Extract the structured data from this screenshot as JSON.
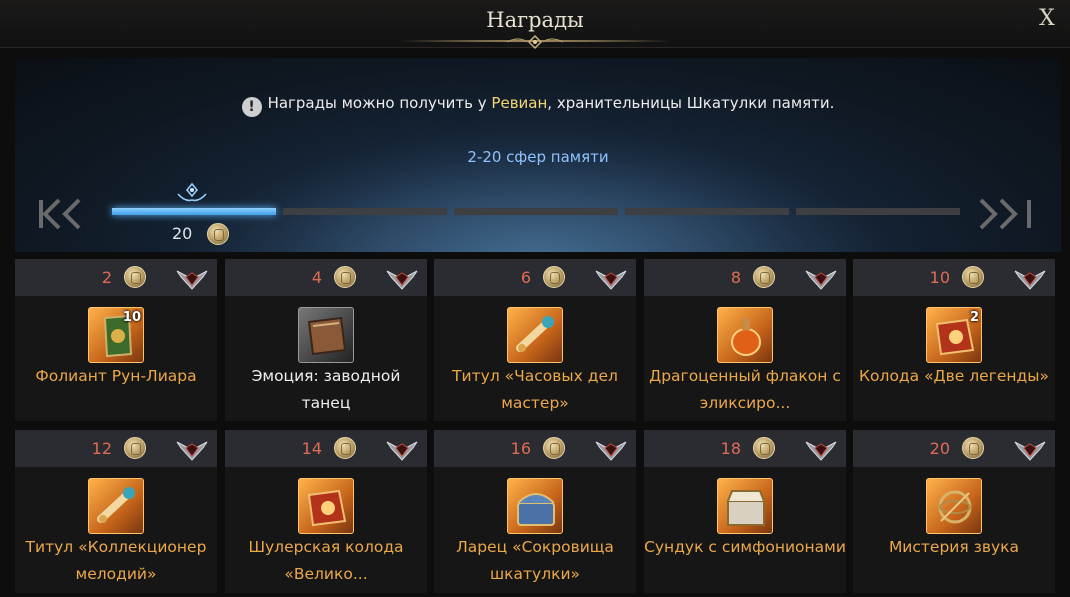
{
  "window": {
    "title": "Награды",
    "close_label": "X"
  },
  "notice": {
    "prefix": "Награды можно получить у ",
    "highlight": "Ревиан",
    "suffix": ", хранительницы Шкатулки памяти.",
    "info_icon": "!"
  },
  "progress": {
    "range_label": "2-20 сфер памяти",
    "current_count": "20",
    "segments_total": 5,
    "segments_filled": 1,
    "nav_left": "K‹",
    "nav_right": "›K"
  },
  "rewards": [
    {
      "required": "2",
      "name": "Фолиант Рун-Лиара",
      "quantity": "10",
      "icon": "rune-folio-icon",
      "rarity_color": "#eaa84a"
    },
    {
      "required": "4",
      "name": "Эмоция: заводной танец",
      "quantity": "",
      "icon": "emote-book-icon",
      "rarity_color": "#efefef"
    },
    {
      "required": "6",
      "name": "Титул «Часовых дел мастер»",
      "quantity": "",
      "icon": "title-scroll-icon",
      "rarity_color": "#eaa84a"
    },
    {
      "required": "8",
      "name": "Драгоценный флакон с эликсиро...",
      "quantity": "",
      "icon": "elixir-flask-icon",
      "rarity_color": "#eaa84a"
    },
    {
      "required": "10",
      "name": "Колода «Две легенды»",
      "quantity": "2",
      "icon": "card-deck-icon",
      "rarity_color": "#eaa84a"
    },
    {
      "required": "12",
      "name": "Титул «Коллекционер мелодий»",
      "quantity": "",
      "icon": "title-scroll-icon",
      "rarity_color": "#eaa84a"
    },
    {
      "required": "14",
      "name": "Шулерская колода «Велико...",
      "quantity": "",
      "icon": "card-deck-icon",
      "rarity_color": "#eaa84a"
    },
    {
      "required": "16",
      "name": "Ларец «Сокровища шкатулки»",
      "quantity": "",
      "icon": "treasure-chest-icon",
      "rarity_color": "#eaa84a"
    },
    {
      "required": "18",
      "name": "Сундук с симфонионами",
      "quantity": "",
      "icon": "music-box-chest-icon",
      "rarity_color": "#eaa84a"
    },
    {
      "required": "20",
      "name": "Мистерия звука",
      "quantity": "",
      "icon": "armillary-sphere-icon",
      "rarity_color": "#eaa84a"
    }
  ]
}
